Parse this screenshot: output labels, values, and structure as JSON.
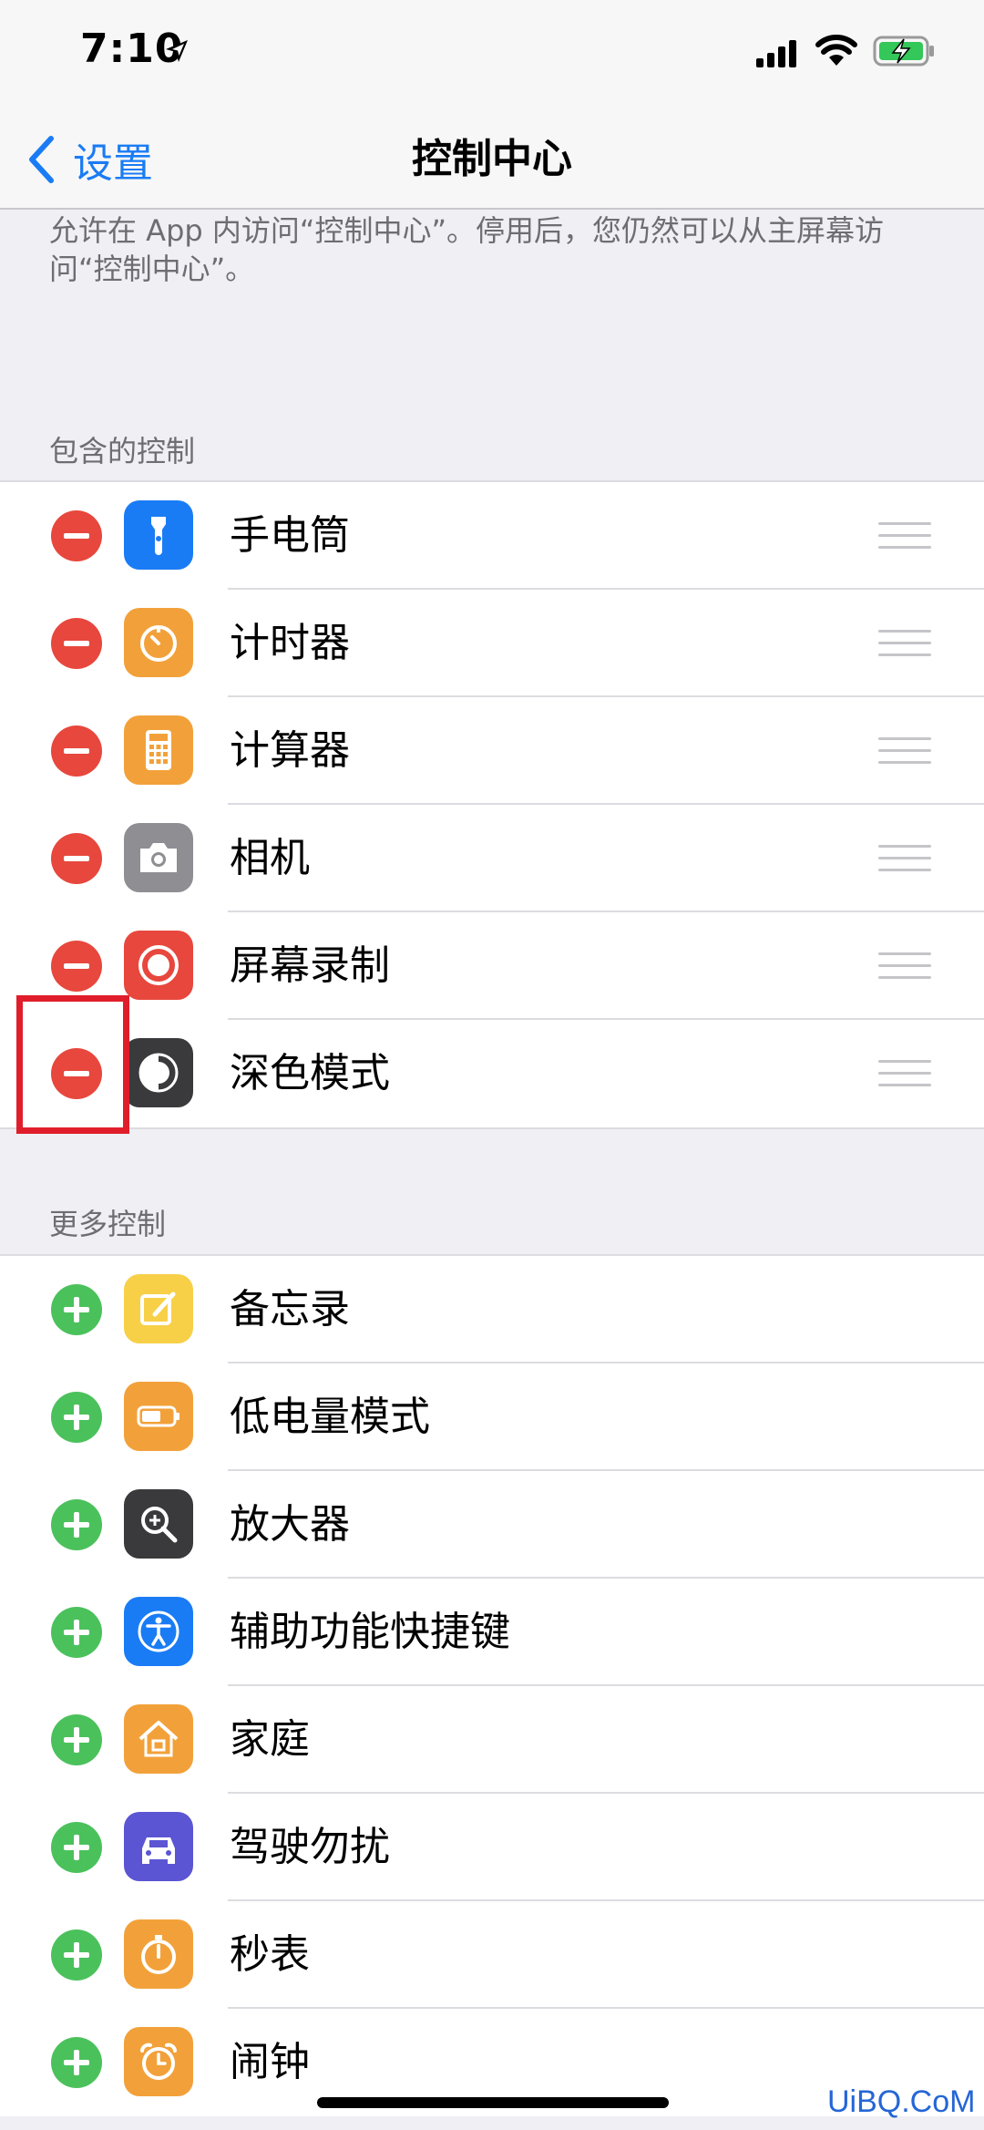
{
  "status_bar": {
    "time": "7:10"
  },
  "nav": {
    "back_label": "设置",
    "title": "控制中心"
  },
  "description": "允许在 App 内访问“控制中心”。停用后，您仍然可以从主屏幕访问“控制中心”。",
  "included": {
    "header": "包含的控制",
    "items": [
      {
        "label": "手电筒",
        "icon": "flashlight-icon",
        "color": "#1a7cf5"
      },
      {
        "label": "计时器",
        "icon": "timer-icon",
        "color": "#f2a13a"
      },
      {
        "label": "计算器",
        "icon": "calculator-icon",
        "color": "#f2a13a"
      },
      {
        "label": "相机",
        "icon": "camera-icon",
        "color": "#8e8e93"
      },
      {
        "label": "屏幕录制",
        "icon": "screen-record-icon",
        "color": "#e7473d"
      },
      {
        "label": "深色模式",
        "icon": "dark-mode-icon",
        "color": "#3a3a3c"
      }
    ]
  },
  "more": {
    "header": "更多控制",
    "items": [
      {
        "label": "备忘录",
        "icon": "notes-icon",
        "color": "#f7d048"
      },
      {
        "label": "低电量模式",
        "icon": "low-power-icon",
        "color": "#f2a13a"
      },
      {
        "label": "放大器",
        "icon": "magnifier-icon",
        "color": "#3a3a3c"
      },
      {
        "label": "辅助功能快捷键",
        "icon": "accessibility-icon",
        "color": "#1a7cf5"
      },
      {
        "label": "家庭",
        "icon": "home-icon",
        "color": "#f2a13a"
      },
      {
        "label": "驾驶勿扰",
        "icon": "car-icon",
        "color": "#5b55d4"
      },
      {
        "label": "秒表",
        "icon": "stopwatch-icon",
        "color": "#f2a13a"
      },
      {
        "label": "闹钟",
        "icon": "alarm-icon",
        "color": "#f2a13a"
      }
    ]
  },
  "watermark": "UiBQ.CoM"
}
